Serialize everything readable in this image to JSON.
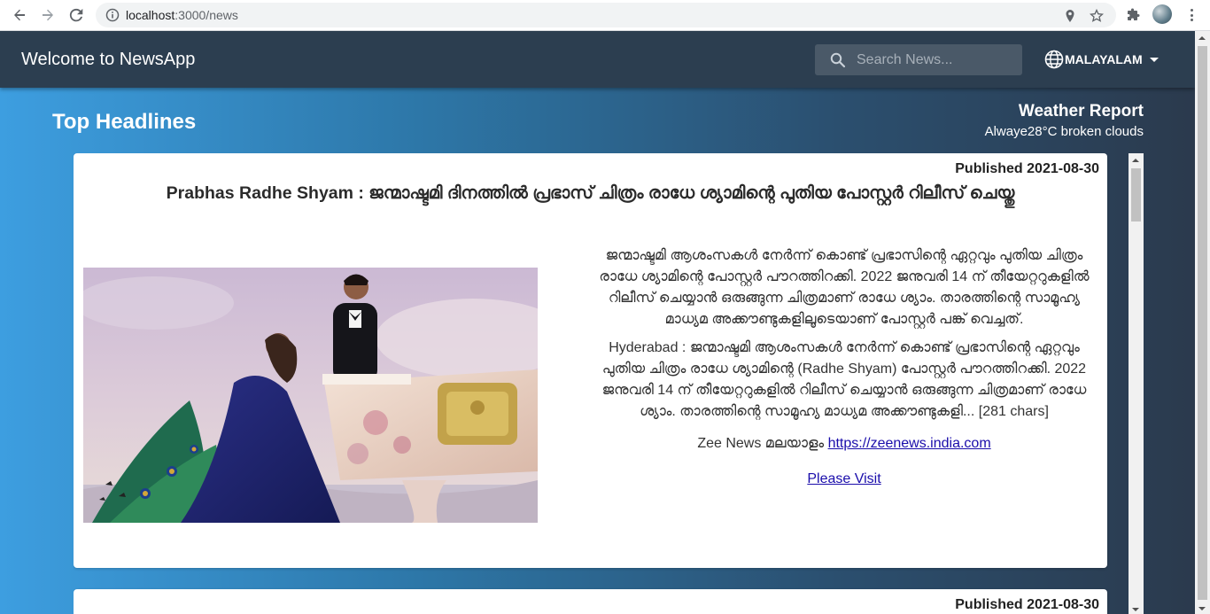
{
  "browser": {
    "url_host": "localhost",
    "url_rest": ":3000/news",
    "icons": [
      "back-icon",
      "forward-icon",
      "reload-icon",
      "info-icon",
      "location-icon",
      "star-icon",
      "extensions-icon",
      "profile-avatar",
      "menu-icon"
    ]
  },
  "navbar": {
    "brand": "Welcome to NewsApp",
    "search_placeholder": "Search News...",
    "language": "MALAYALAM"
  },
  "page": {
    "heading": "Top Headlines"
  },
  "weather": {
    "title": "Weather Report",
    "body": "Alwaye28°C broken clouds"
  },
  "articles": [
    {
      "published": "Published 2021-08-30",
      "title": "Prabhas Radhe Shyam : ജന്മാഷ്ടമി ദിനത്തിൽ പ്രഭാസ് ചിത്രം രാധേ ശ്യാമിന്റെ പുതിയ പോസ്റ്റർ റിലീസ് ചെയ്തു",
      "description": "ജന്മാഷ്ടമി ആശംസകൾ നേർന്ന് കൊണ്ട് പ്രഭാസിന്റെ ഏറ്റവും പുതിയ ചിത്രം രാധേ ശ്യാമിന്റെ പോസ്റ്റർ പൗറത്തിറക്കി. 2022 ജനുവരി 14 ന് തീയേറ്ററുകളിൽ റിലീസ് ചെയ്യാൻ ഒരുങ്ങുന്ന ചിത്രമാണ് രാധേ ശ്യാം. താരത്തിന്റെ സാമൂഹ്യ മാധ്യമ അക്കൗണ്ടുകളിലൂടെയാണ് പോസ്റ്റർ പങ്ക് വെച്ചത്.",
      "content": "Hyderabad : ജന്മാഷ്ടമി ആശംസകൾ നേർന്ന് കൊണ്ട് പ്രഭാസിന്റെ ഏറ്റവും പുതിയ ചിത്രം രാധേ ശ്യാമിന്റെ (Radhe Shyam) പോസ്റ്റർ പൗറത്തിറക്കി. 2022 ജനുവരി 14 ന് തീയേറ്ററുകളിൽ റിലീസ് ചെയ്യാൻ ഒരുങ്ങുന്ന ചിത്രമാണ് രാധേ ശ്യാം. താരത്തിന്റെ സാമൂഹ്യ മാധ്യമ അക്കൗണ്ടുകളി... [281 chars]",
      "source_name": "Zee News മലയാളം",
      "source_url": "https://zeenews.india.com",
      "visit_label": "Please Visit"
    },
    {
      "published": "Published 2021-08-30"
    }
  ],
  "colors": {
    "navbar": "#2c3e50",
    "gradient_left": "#3d9ee0",
    "gradient_right": "#2b3a4d",
    "link": "#1a0dab"
  }
}
